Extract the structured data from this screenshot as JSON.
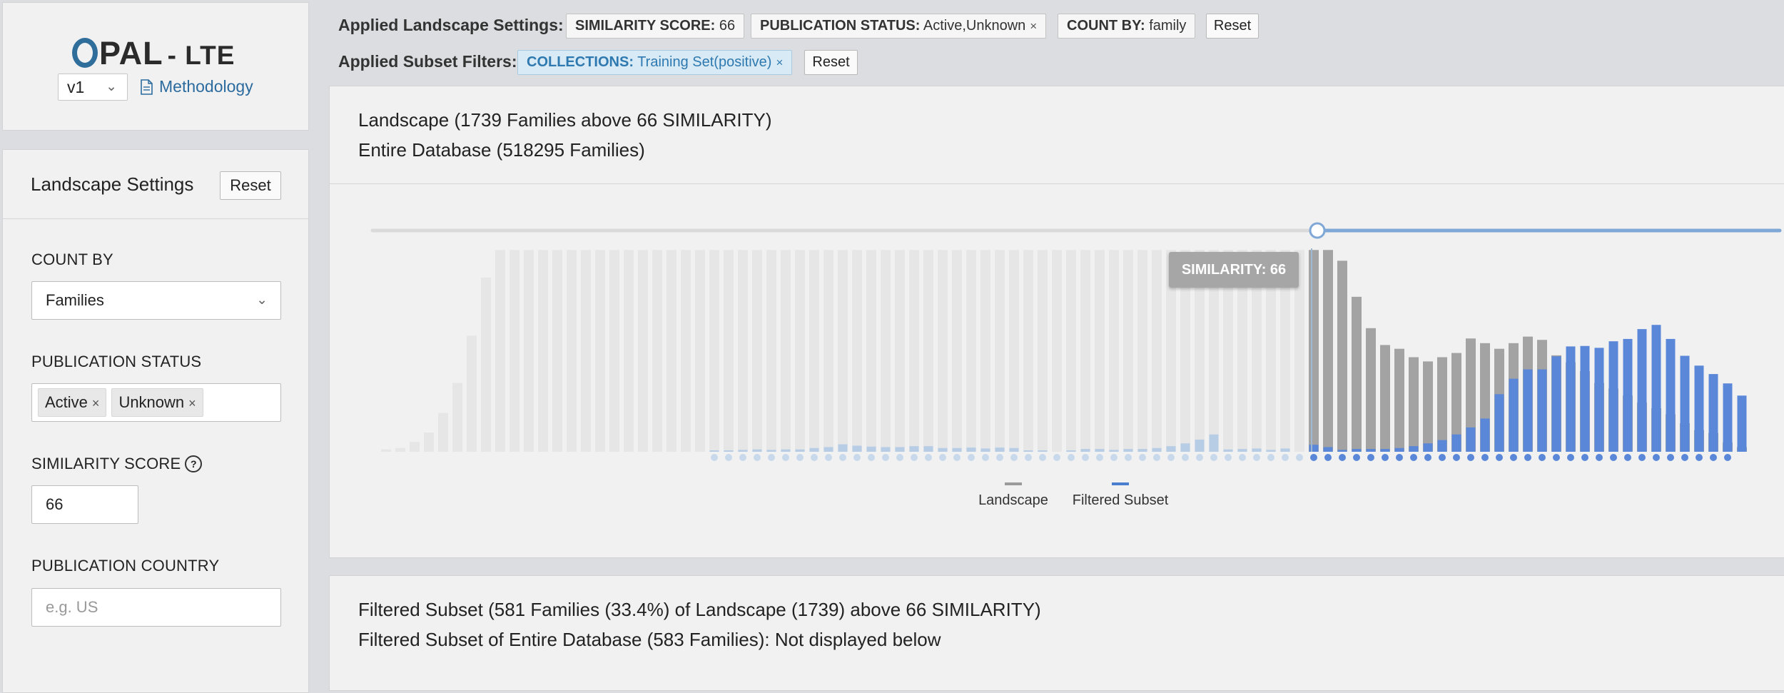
{
  "logo": {
    "brand_rest": "PAL",
    "suffix": "- LTE"
  },
  "version": {
    "selected": "v1"
  },
  "methodology_label": "Methodology",
  "filter_bar": {
    "landscape_label": "Applied Landscape Settings:",
    "subset_label": "Applied Subset Filters:",
    "reset_label": "Reset",
    "landscape_chips": [
      {
        "key": "SIMILARITY SCORE:",
        "value": "66",
        "removable": false
      },
      {
        "key": "PUBLICATION STATUS:",
        "value": "Active,Unknown",
        "removable": true
      },
      {
        "key": "COUNT BY:",
        "value": "family",
        "removable": false
      }
    ],
    "subset_chips": [
      {
        "key": "COLLECTIONS:",
        "value": "Training Set(positive)",
        "removable": true
      }
    ]
  },
  "settings": {
    "title": "Landscape Settings",
    "reset_label": "Reset",
    "count_by": {
      "label": "COUNT BY",
      "value": "Families"
    },
    "publication_status": {
      "label": "PUBLICATION STATUS",
      "tags": [
        "Active",
        "Unknown"
      ]
    },
    "similarity_score": {
      "label": "SIMILARITY SCORE",
      "value": "66"
    },
    "publication_country": {
      "label": "PUBLICATION COUNTRY",
      "placeholder": "e.g. US"
    }
  },
  "landscape": {
    "line1": "Landscape (1739 Families above 66 SIMILARITY)",
    "line2": "Entire Database (518295 Families)"
  },
  "subset": {
    "line1": "Filtered Subset (581 Families (33.4%) of Landscape (1739) above 66 SIMILARITY)",
    "line2": "Filtered Subset of Entire Database (583 Families): Not displayed below"
  },
  "chart_data": {
    "type": "bar",
    "threshold": 66,
    "threshold_index": 65,
    "tooltip": "SIMILARITY: 66",
    "colors": {
      "landscape_active": "#a3a3a3",
      "landscape_inactive": "#e6e6e6",
      "subset": "#5a87d8",
      "subset_faint": "#b7cde6",
      "slider": "#7fa8d7"
    },
    "series": [
      {
        "name": "Landscape",
        "values": [
          0.5,
          0.8,
          2.1,
          4.1,
          8.3,
          14.7,
          24.8,
          37.2,
          43.1,
          43.1,
          43.1,
          43.1,
          43.1,
          43.1,
          43.1,
          43.1,
          43.1,
          43.1,
          43.1,
          43.1,
          43.1,
          43.1,
          43.1,
          43.1,
          43.1,
          43.1,
          43.1,
          43.1,
          43.1,
          43.1,
          43.1,
          43.1,
          43.1,
          43.1,
          43.1,
          43.1,
          43.1,
          43.1,
          43.1,
          43.1,
          43.1,
          43.1,
          43.1,
          43.1,
          43.1,
          43.1,
          43.1,
          43.1,
          43.1,
          43.1,
          43.1,
          43.1,
          43.1,
          43.1,
          43.1,
          43.1,
          43.1,
          43.1,
          43.1,
          43.1,
          43.1,
          43.1,
          43.1,
          43.1,
          43.1,
          43.1,
          43.1,
          40.8,
          33.1,
          26.4,
          22.8,
          22.0,
          20.2,
          19.3,
          20.2,
          21.1,
          24.2,
          23.2,
          22.0,
          23.2,
          24.6,
          23.9,
          20.6,
          19.1,
          17.2,
          14.7,
          13.5,
          12.0,
          10.5,
          9.3,
          8.0,
          6.1,
          4.6,
          4.0,
          2.0,
          1.0
        ]
      },
      {
        "name": "Filtered Subset",
        "values": [
          0,
          0,
          0,
          0,
          0,
          0,
          0,
          0,
          0,
          0,
          0,
          0,
          0,
          0,
          0,
          0,
          0,
          0,
          0,
          0,
          0,
          0,
          0,
          0.3,
          0.3,
          0.4,
          0.5,
          0.4,
          0.5,
          0.5,
          0.8,
          1.0,
          1.6,
          1.3,
          1.1,
          1.0,
          1.0,
          1.2,
          1.2,
          0.8,
          0.8,
          0.9,
          0.7,
          0.9,
          0.8,
          0.3,
          0.3,
          0,
          0.3,
          0.6,
          0.6,
          0.4,
          0.6,
          0.6,
          0.8,
          1.2,
          1.8,
          2.6,
          3.7,
          0.5,
          0.6,
          0.7,
          0.4,
          0.7,
          0,
          1.5,
          1.0,
          0.4,
          0.6,
          0.6,
          0.6,
          0.8,
          1.2,
          1.8,
          2.5,
          3.7,
          5.2,
          7.1,
          12.3,
          15.6,
          17.6,
          17.6,
          20.4,
          22.5,
          22.6,
          22.2,
          23.6,
          24.1,
          26.2,
          27.1,
          24.1,
          20.5,
          18.4,
          16.6,
          14.6,
          12.0
        ]
      }
    ],
    "legend": [
      "Landscape",
      "Filtered Subset"
    ]
  }
}
